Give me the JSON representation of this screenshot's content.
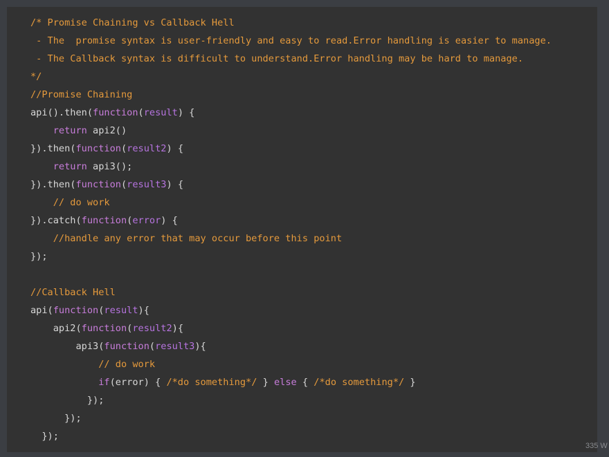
{
  "colors": {
    "background": "#3b3e43",
    "panel": "#323232",
    "comment": "#e59a3c",
    "plain": "#d8d8d8",
    "keyword": "#c87ddb",
    "param": "#b774e0"
  },
  "code": {
    "lines": [
      [
        {
          "t": "/* Promise Chaining vs Callback Hell",
          "c": "c"
        }
      ],
      [
        {
          "t": " - The  promise syntax is user-friendly and easy to read.Error handling is easier to manage.",
          "c": "c"
        }
      ],
      [
        {
          "t": " - The Callback syntax is difficult to understand.Error handling may be hard to manage.",
          "c": "c"
        }
      ],
      [
        {
          "t": "*/",
          "c": "c"
        }
      ],
      [
        {
          "t": "//Promise Chaining",
          "c": "c"
        }
      ],
      [
        {
          "t": "api().then(",
          "c": "p"
        },
        {
          "t": "function",
          "c": "k"
        },
        {
          "t": "(",
          "c": "p"
        },
        {
          "t": "result",
          "c": "v"
        },
        {
          "t": ") {",
          "c": "p"
        }
      ],
      [
        {
          "t": "    ",
          "c": "p"
        },
        {
          "t": "return",
          "c": "k"
        },
        {
          "t": " api2()",
          "c": "p"
        }
      ],
      [
        {
          "t": "}).then(",
          "c": "p"
        },
        {
          "t": "function",
          "c": "k"
        },
        {
          "t": "(",
          "c": "p"
        },
        {
          "t": "result2",
          "c": "v"
        },
        {
          "t": ") {",
          "c": "p"
        }
      ],
      [
        {
          "t": "    ",
          "c": "p"
        },
        {
          "t": "return",
          "c": "k"
        },
        {
          "t": " api3();",
          "c": "p"
        }
      ],
      [
        {
          "t": "}).then(",
          "c": "p"
        },
        {
          "t": "function",
          "c": "k"
        },
        {
          "t": "(",
          "c": "p"
        },
        {
          "t": "result3",
          "c": "v"
        },
        {
          "t": ") {",
          "c": "p"
        }
      ],
      [
        {
          "t": "    // do work",
          "c": "c"
        }
      ],
      [
        {
          "t": "}).catch(",
          "c": "p"
        },
        {
          "t": "function",
          "c": "k"
        },
        {
          "t": "(",
          "c": "p"
        },
        {
          "t": "error",
          "c": "v"
        },
        {
          "t": ") {",
          "c": "p"
        }
      ],
      [
        {
          "t": "    //handle any error that may occur before this point",
          "c": "c"
        }
      ],
      [
        {
          "t": "});",
          "c": "p"
        }
      ],
      [
        {
          "t": "",
          "c": "p"
        }
      ],
      [
        {
          "t": "//Callback Hell",
          "c": "c"
        }
      ],
      [
        {
          "t": "api(",
          "c": "p"
        },
        {
          "t": "function",
          "c": "k"
        },
        {
          "t": "(",
          "c": "p"
        },
        {
          "t": "result",
          "c": "v"
        },
        {
          "t": "){",
          "c": "p"
        }
      ],
      [
        {
          "t": "    api2(",
          "c": "p"
        },
        {
          "t": "function",
          "c": "k"
        },
        {
          "t": "(",
          "c": "p"
        },
        {
          "t": "result2",
          "c": "v"
        },
        {
          "t": "){",
          "c": "p"
        }
      ],
      [
        {
          "t": "        api3(",
          "c": "p"
        },
        {
          "t": "function",
          "c": "k"
        },
        {
          "t": "(",
          "c": "p"
        },
        {
          "t": "result3",
          "c": "v"
        },
        {
          "t": "){",
          "c": "p"
        }
      ],
      [
        {
          "t": "            // do work",
          "c": "c"
        }
      ],
      [
        {
          "t": "            ",
          "c": "p"
        },
        {
          "t": "if",
          "c": "k"
        },
        {
          "t": "(error) { ",
          "c": "p"
        },
        {
          "t": "/*do something*/",
          "c": "c"
        },
        {
          "t": " } ",
          "c": "p"
        },
        {
          "t": "else",
          "c": "k"
        },
        {
          "t": " { ",
          "c": "p"
        },
        {
          "t": "/*do something*/",
          "c": "c"
        },
        {
          "t": " }",
          "c": "p"
        }
      ],
      [
        {
          "t": "          });",
          "c": "p"
        }
      ],
      [
        {
          "t": "      });",
          "c": "p"
        }
      ],
      [
        {
          "t": "  });",
          "c": "p"
        }
      ]
    ]
  },
  "status": {
    "word_count": "335 W"
  }
}
